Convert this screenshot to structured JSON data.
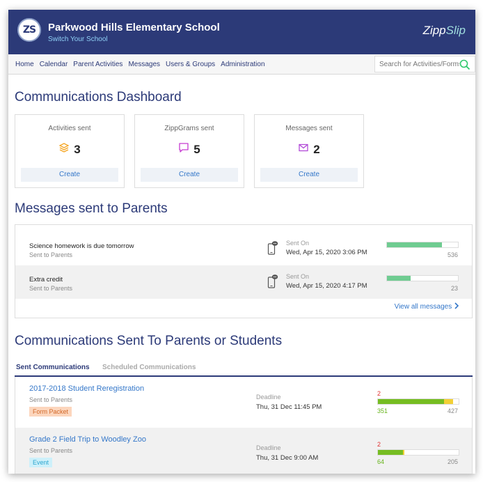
{
  "header": {
    "logo_text": "ZS",
    "school_name": "Parkwood Hills Elementary School",
    "switch_school": "Switch Your School",
    "brand_zipp": "Zipp",
    "brand_slip": "Slip"
  },
  "nav": {
    "items": [
      "Home",
      "Calendar",
      "Parent Activities",
      "Messages",
      "Users & Groups",
      "Administration"
    ],
    "search_placeholder": "Search for Activities/Forms"
  },
  "dashboard": {
    "title": "Communications Dashboard",
    "cards": [
      {
        "label": "Activities sent",
        "count": "3",
        "button": "Create",
        "icon": "layers-icon",
        "color": "#f5a623"
      },
      {
        "label": "ZippGrams sent",
        "count": "5",
        "button": "Create",
        "icon": "chat-bubble-icon",
        "color": "#c63bd1"
      },
      {
        "label": "Messages sent",
        "count": "2",
        "button": "Create",
        "icon": "envelope-icon",
        "color": "#b24bd8"
      }
    ]
  },
  "messages": {
    "title": "Messages sent to Parents",
    "sent_on_label": "Sent On",
    "view_all": "View all messages",
    "rows": [
      {
        "title": "Science homework is due tomorrow",
        "sub": "Sent to Parents",
        "date": "Wed, Apr 15, 2020 3:06 PM",
        "count": "536",
        "progress": 0.77
      },
      {
        "title": "Extra credit",
        "sub": "Sent to Parents",
        "date": "Wed, Apr 15, 2020 4:17 PM",
        "count": "23",
        "progress": 0.33
      }
    ]
  },
  "communications": {
    "title": "Communications Sent To Parents or Students",
    "tabs": [
      "Sent Communications",
      "Scheduled Communications"
    ],
    "deadline_label": "Deadline",
    "rows": [
      {
        "title": "2017-2018 Student Reregistration",
        "sub": "Sent to Parents",
        "tag": "Form Packet",
        "date": "Thu, 31 Dec 11:45 PM",
        "red": "2",
        "green": "351",
        "total": "427",
        "green_frac": 0.82,
        "yellow_frac": 0.11
      },
      {
        "title": "Grade 2 Field Trip to Woodley Zoo",
        "sub": "Sent to Parents",
        "tag": "Event",
        "date": "Thu, 31 Dec 9:00 AM",
        "red": "2",
        "green": "64",
        "total": "205",
        "green_frac": 0.31,
        "yellow_frac": 0.02
      }
    ]
  },
  "colors": {
    "header_bg": "#2c3a78",
    "link": "#3477c9",
    "progress_green": "#6fcc91"
  }
}
